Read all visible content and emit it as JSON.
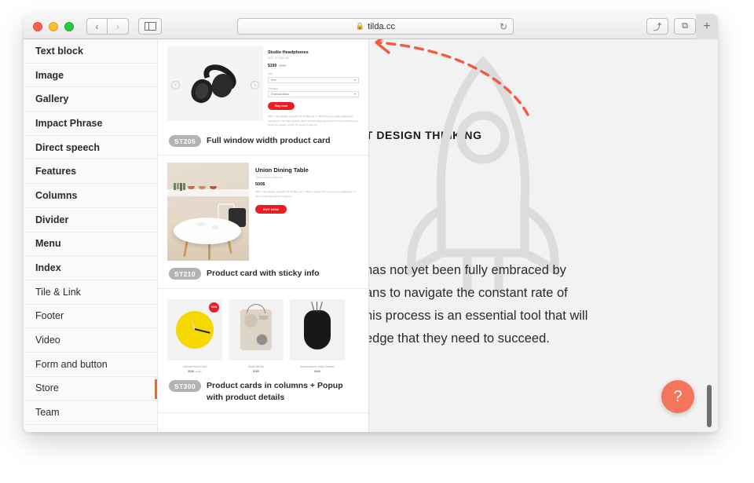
{
  "browser": {
    "url": "tilda.cc",
    "lock_icon": "lock-icon",
    "back_label": "‹",
    "forward_label": "›",
    "reload_label": "↻",
    "share_label": "⤴",
    "tabs_label": "⧉",
    "newtab_label": "+"
  },
  "catalog": {
    "items": [
      {
        "label": "Text block",
        "bold": true,
        "active": false
      },
      {
        "label": "Image",
        "bold": true,
        "active": false
      },
      {
        "label": "Gallery",
        "bold": true,
        "active": false
      },
      {
        "label": "Impact Phrase",
        "bold": true,
        "active": false
      },
      {
        "label": "Direct speech",
        "bold": true,
        "active": false
      },
      {
        "label": "Features",
        "bold": true,
        "active": false
      },
      {
        "label": "Columns",
        "bold": true,
        "active": false
      },
      {
        "label": "Divider",
        "bold": true,
        "active": false
      },
      {
        "label": "Menu",
        "bold": true,
        "active": false
      },
      {
        "label": "Index",
        "bold": true,
        "active": false
      },
      {
        "label": "Tile & Link",
        "bold": false,
        "active": false
      },
      {
        "label": "Footer",
        "bold": false,
        "active": false
      },
      {
        "label": "Video",
        "bold": false,
        "active": false
      },
      {
        "label": "Form and button",
        "bold": false,
        "active": false
      },
      {
        "label": "Store",
        "bold": false,
        "active": true
      },
      {
        "label": "Team",
        "bold": false,
        "active": false
      }
    ]
  },
  "blocks": [
    {
      "code": "ST205",
      "title": "Full window width product card",
      "product": {
        "name": "Studio Headphones",
        "sku": "SKU: ST-0402-BK",
        "price": "$199",
        "old_price": "$299",
        "size_label": "Size",
        "size_value": "Size",
        "color_label": "Finishing",
        "color_value": "Charcoal Black",
        "button": "Buy now",
        "description": "With a new design approach for flexible use, it offers the best audio engineering experience. The high dynamic driver delivers deep bass and rich sound, and the ear cushions provide comfort for hours of listening."
      }
    },
    {
      "code": "ST210",
      "title": "Product card with sticky info",
      "product": {
        "name": "Union Dining Table",
        "sku": "Table which unites us",
        "price": "500$",
        "button": "BUY NOW",
        "description": "With a new design approach for flexible use, it offers a simple formula to a long celebration. A piece of furniture for all occasions."
      }
    },
    {
      "code": "ST300",
      "title": "Product cards in columns + Popup with product details",
      "columns": [
        {
          "name": "Celenda Round Clock",
          "price": "$130",
          "old_price": "$190",
          "badge": "NEW",
          "icon": "clock-icon"
        },
        {
          "name": "Radio MiniLith",
          "price": "$160",
          "old_price": "",
          "badge": "",
          "icon": "radio-icon"
        },
        {
          "name": "Accessories by Union Ceramic",
          "price": "$140",
          "old_price": "",
          "badge": "",
          "icon": "vase-icon"
        }
      ]
    }
  ],
  "page": {
    "heading": "UT DESIGN THINKING",
    "body_lines": [
      "has not yet been fully embraced by",
      "ans to navigate the constant rate of",
      "his process is an essential tool that will",
      "edge that they need to succeed."
    ],
    "watermark": "rocket-icon",
    "annotation_arrow": "dashed-arrow-icon"
  },
  "help": {
    "label": "?"
  },
  "colors": {
    "accent_orange": "#f26522",
    "help_orange": "#f4745c",
    "buy_red": "#ed1c24",
    "pill_gray": "#b3b3b3"
  }
}
